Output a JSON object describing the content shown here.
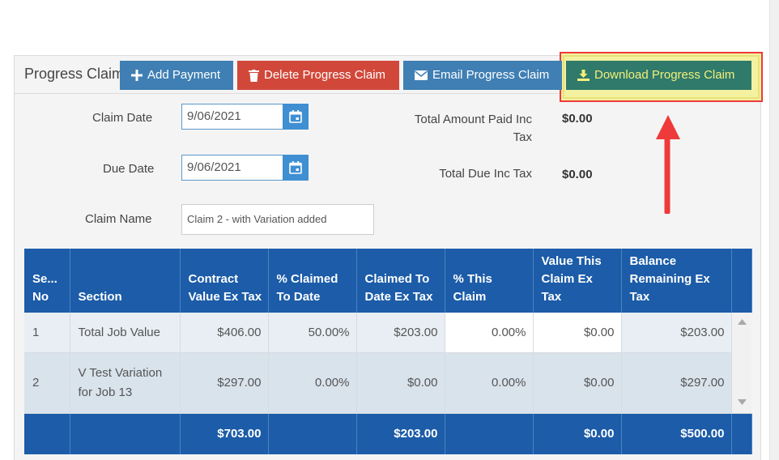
{
  "panel": {
    "title": "Progress Claim"
  },
  "toolbar": {
    "add_payment": "Add Payment",
    "delete_claim": "Delete Progress Claim",
    "email_claim": "Email Progress Claim",
    "download_claim": "Download Progress Claim"
  },
  "form": {
    "claim_date_label": "Claim Date",
    "claim_date_value": "9/06/2021",
    "due_date_label": "Due Date",
    "due_date_value": "9/06/2021",
    "claim_name_label": "Claim Name",
    "claim_name_placeholder": "Claim 2 - with Variation added",
    "total_paid_label_1": "Total Amount Paid Inc",
    "total_paid_label_2": "Tax",
    "total_paid_value": "$0.00",
    "total_due_label": "Total Due Inc Tax",
    "total_due_value": "$0.00"
  },
  "table": {
    "headers": [
      [
        "Se...",
        "No"
      ],
      [
        "Section"
      ],
      [
        "Contract",
        "Value Ex Tax"
      ],
      [
        "% Claimed",
        "To Date"
      ],
      [
        "Claimed To",
        "Date Ex Tax"
      ],
      [
        "% This",
        "Claim"
      ],
      [
        "Value This",
        "Claim Ex",
        "Tax"
      ],
      [
        "Balance",
        "Remaining Ex",
        "Tax"
      ]
    ],
    "rows": [
      {
        "no": "1",
        "section_1": "Total Job Value",
        "section_2": "",
        "contract": "$406.00",
        "pct_to_date": "50.00%",
        "claimed_to_date": "$203.00",
        "pct_this": "0.00%",
        "value_this": "$0.00",
        "balance": "$203.00"
      },
      {
        "no": "2",
        "section_1": "V Test Variation",
        "section_2": "for Job 13",
        "contract": "$297.00",
        "pct_to_date": "0.00%",
        "claimed_to_date": "$0.00",
        "pct_this": "0.00%",
        "value_this": "$0.00",
        "balance": "$297.00"
      }
    ],
    "totals": {
      "contract": "$703.00",
      "claimed_to_date": "$203.00",
      "value_this": "$0.00",
      "balance": "$500.00"
    }
  },
  "colors": {
    "primary": "#3f7fb4",
    "danger": "#d1483a",
    "download": "#2f7a6b",
    "table_header": "#1c5ca8",
    "annotation": "#ee3a3a"
  }
}
